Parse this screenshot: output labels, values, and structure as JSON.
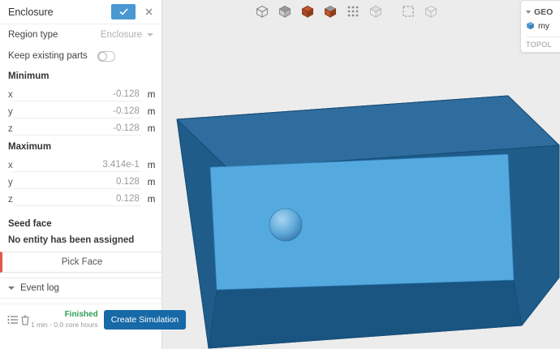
{
  "toolbar": {
    "icons": [
      {
        "name": "box-outline"
      },
      {
        "name": "box-shaded"
      },
      {
        "name": "box-active"
      },
      {
        "name": "box-mixed"
      },
      {
        "name": "lattice"
      },
      {
        "name": "box-faint"
      },
      {
        "name": "box-select"
      },
      {
        "name": "box-ghost"
      }
    ]
  },
  "panel": {
    "title": "Enclosure",
    "region_type": {
      "label": "Region type",
      "value": "Enclosure"
    },
    "keep_existing": {
      "label": "Keep existing parts"
    },
    "minimum": {
      "label": "Minimum",
      "x": {
        "label": "x",
        "value": "-0.128",
        "unit": "m"
      },
      "y": {
        "label": "y",
        "value": "-0.128",
        "unit": "m"
      },
      "z": {
        "label": "z",
        "value": "-0.128",
        "unit": "m"
      }
    },
    "maximum": {
      "label": "Maximum",
      "x": {
        "label": "x",
        "value": "3.414e-1",
        "unit": "m"
      },
      "y": {
        "label": "y",
        "value": "0.128",
        "unit": "m"
      },
      "z": {
        "label": "z",
        "value": "0.128",
        "unit": "m"
      }
    },
    "seed_face": {
      "label": "Seed face",
      "empty": "No entity has been assigned",
      "pick_button": "Pick Face"
    },
    "event_log": {
      "label": "Event log"
    },
    "footer": {
      "status": "Finished",
      "meta": "1 min - 0.0 core hours",
      "create": "Create Simulation"
    }
  },
  "right_panel": {
    "header": "GEO",
    "item": "my",
    "section": "TOPOL"
  },
  "colors": {
    "accent_blue": "#4a97d2",
    "primary_button": "#1769a7",
    "status_green": "#2f9e55",
    "selection_red": "#e2574c",
    "active_orange": "#c2572d",
    "active_orange_dark": "#8f3e1d",
    "box_base": "#1f5c8a",
    "box_top": "#2e6d9d",
    "box_floor": "#1a5480",
    "box_panel": "#54a9de",
    "box_edge": "#154b76",
    "sphere_light": "#a8d4ef",
    "sphere_mid": "#5fa9da",
    "sphere_dark": "#2e6da0",
    "viewport_bg": "#ececec"
  }
}
